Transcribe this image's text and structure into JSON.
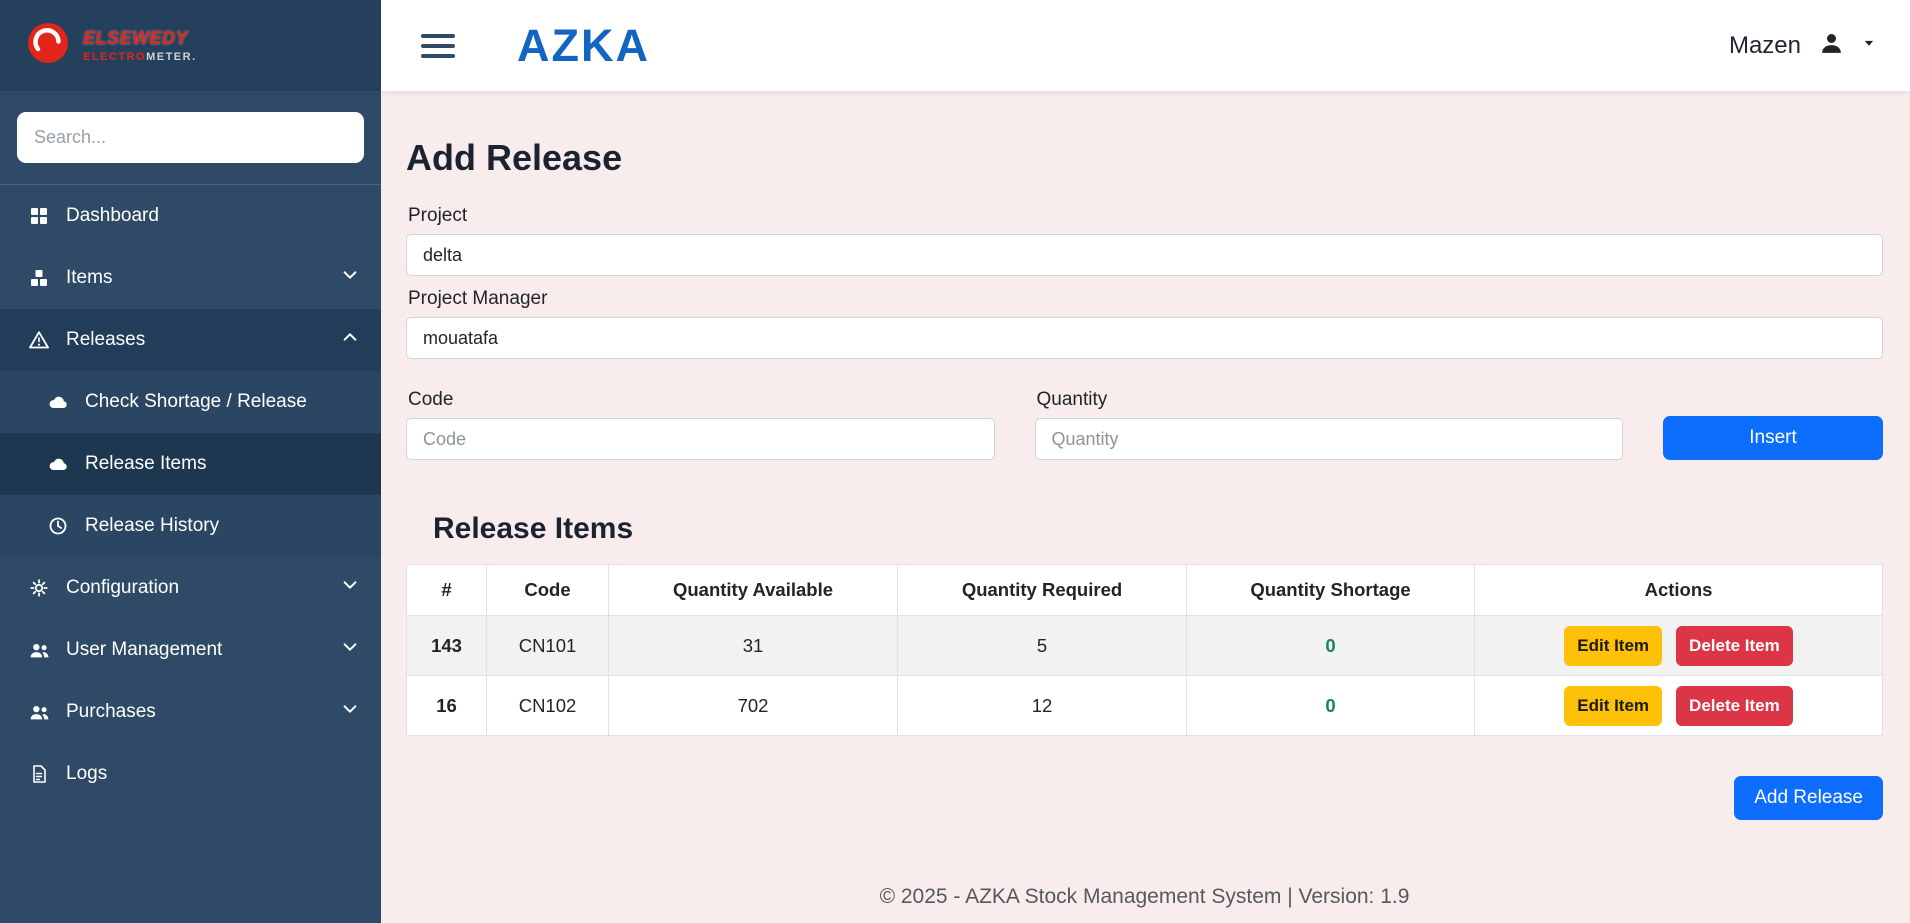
{
  "topbar": {
    "brand": "AZKA",
    "user_name": "Mazen"
  },
  "sidebar": {
    "logo": {
      "line1": "ELSEWEDY",
      "line2_red": "ELECTRO",
      "line2_white": "METER."
    },
    "search_placeholder": "Search...",
    "items": [
      {
        "label": "Dashboard"
      },
      {
        "label": "Items"
      },
      {
        "label": "Releases"
      },
      {
        "label": "Check Shortage / Release"
      },
      {
        "label": "Release Items"
      },
      {
        "label": "Release History"
      },
      {
        "label": "Configuration"
      },
      {
        "label": "User Management"
      },
      {
        "label": "Purchases"
      },
      {
        "label": "Logs"
      }
    ]
  },
  "main": {
    "title": "Add Release",
    "form": {
      "project_label": "Project",
      "project_value": "delta",
      "manager_label": "Project Manager",
      "manager_value": "mouatafa",
      "code_label": "Code",
      "code_placeholder": "Code",
      "quantity_label": "Quantity",
      "quantity_placeholder": "Quantity",
      "insert_button": "Insert"
    },
    "table": {
      "title": "Release Items",
      "headers": [
        "#",
        "Code",
        "Quantity Available",
        "Quantity Required",
        "Quantity Shortage",
        "Actions"
      ],
      "rows": [
        {
          "id": "143",
          "code": "CN101",
          "available": "31",
          "required": "5",
          "shortage": "0"
        },
        {
          "id": "16",
          "code": "CN102",
          "available": "702",
          "required": "12",
          "shortage": "0"
        }
      ],
      "edit_button": "Edit Item",
      "delete_button": "Delete Item"
    },
    "add_release_button": "Add Release",
    "footer": "© 2025 - AZKA Stock Management System | Version: 1.9"
  },
  "colors": {
    "primary": "#0d6efd",
    "warning": "#ffc107",
    "danger": "#dc3545",
    "success": "#198754",
    "sidebar": "#2e4a66",
    "brand_blue": "#1266c0",
    "logo_red": "#e1251b",
    "page_background": "#f8edec"
  }
}
